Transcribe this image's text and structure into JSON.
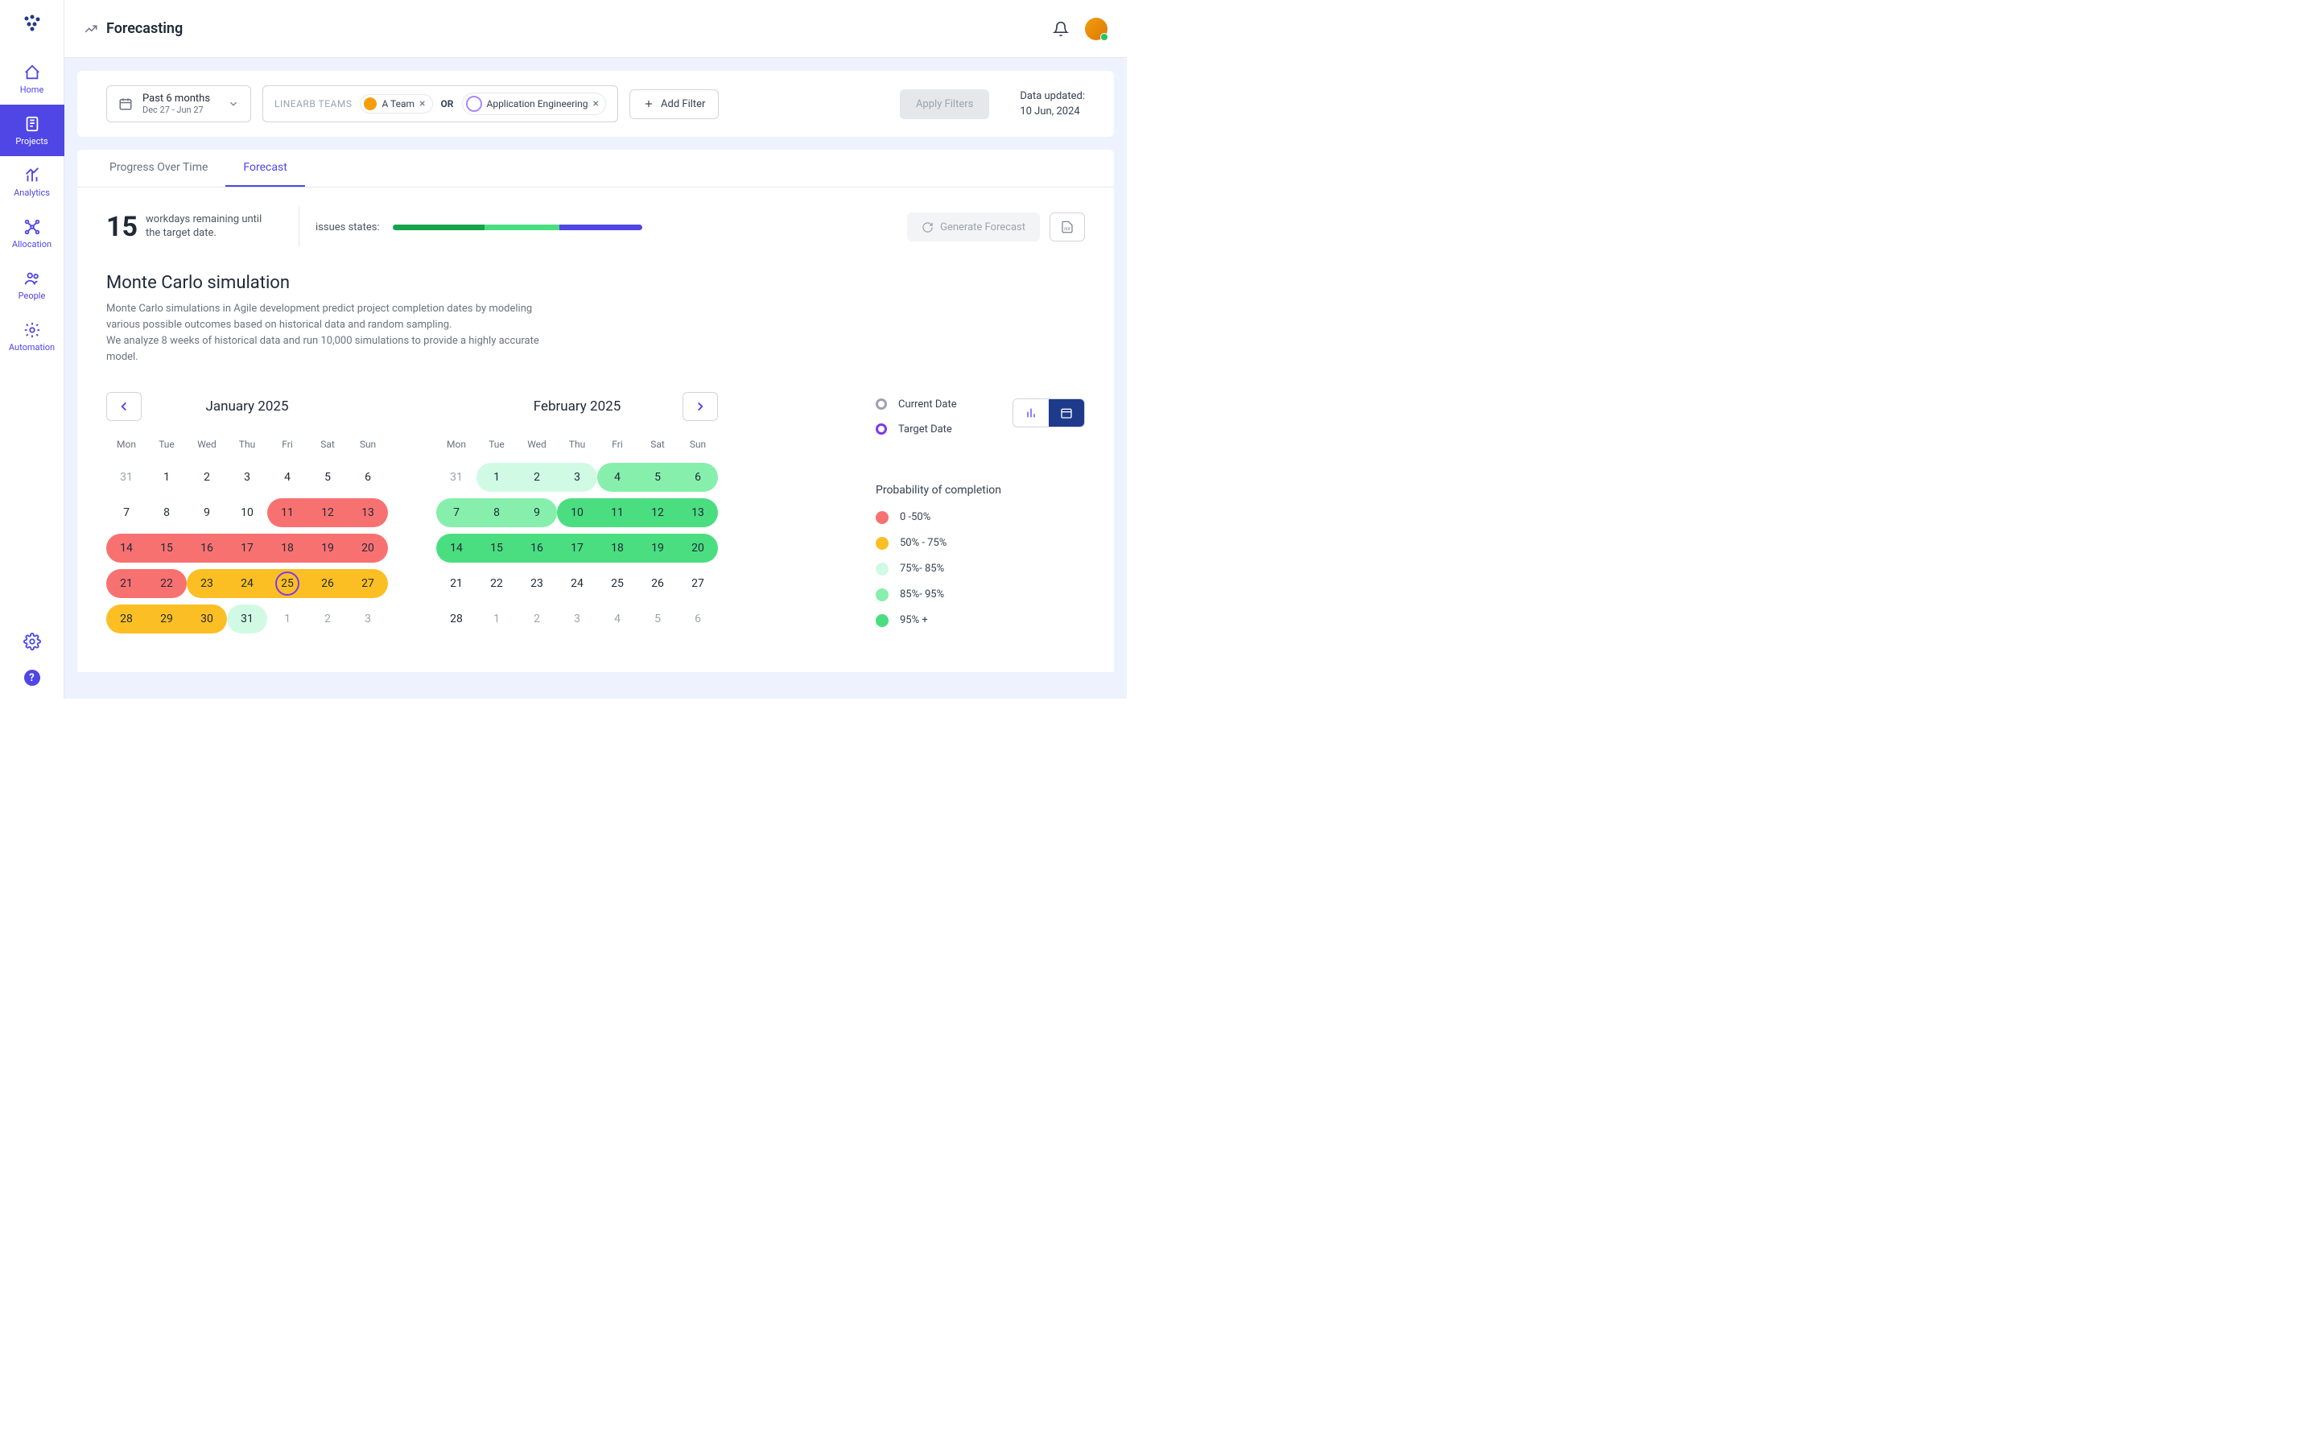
{
  "header": {
    "title": "Forecasting"
  },
  "sidebar": {
    "items": [
      {
        "label": "Home",
        "icon": "home"
      },
      {
        "label": "Projects",
        "icon": "projects",
        "active": true
      },
      {
        "label": "Analytics",
        "icon": "analytics"
      },
      {
        "label": "Allocation",
        "icon": "allocation"
      },
      {
        "label": "People",
        "icon": "people"
      },
      {
        "label": "Automation",
        "icon": "automation"
      }
    ]
  },
  "filters": {
    "date_range_label": "Past 6 months",
    "date_range_sub": "Dec 27 - Jun 27",
    "teams_label": "LINEARB TEAMS",
    "team_a": "A Team",
    "team_b": "Application Engineering",
    "or": "OR",
    "add_filter": "Add Filter",
    "apply": "Apply Filters",
    "data_updated_label": "Data updated:",
    "data_updated_value": "10 Jun, 2024"
  },
  "tabs": {
    "progress": "Progress Over Time",
    "forecast": "Forecast"
  },
  "forecast": {
    "workdays_num": "15",
    "workdays_text": "workdays remaining until the target date.",
    "issues_states_label": "issues states:",
    "generate": "Generate Forecast",
    "mc_title": "Monte Carlo simulation",
    "mc_desc_1": "Monte Carlo simulations in Agile development predict project completion dates by modeling various possible outcomes based on historical data and random sampling.",
    "mc_desc_2": "We analyze 8 weeks of historical data and run 10,000 simulations to provide a highly accurate model."
  },
  "legend": {
    "current_date": "Current Date",
    "target_date": "Target Date",
    "prob_title": "Probability of completion",
    "buckets": [
      {
        "label": "0 -50%",
        "color": "#f87171"
      },
      {
        "label": "50% - 75%",
        "color": "#fbbf24"
      },
      {
        "label": "75%- 85%",
        "color": "#d1fae5"
      },
      {
        "label": "85%- 95%",
        "color": "#86efac"
      },
      {
        "label": "95% +",
        "color": "#4ade80"
      }
    ]
  },
  "calendars": {
    "dow": [
      "Mon",
      "Tue",
      "Wed",
      "Thu",
      "Fri",
      "Sat",
      "Sun"
    ],
    "months": [
      {
        "title": "January 2025",
        "nav": "left",
        "cells": [
          {
            "n": "31",
            "out": true
          },
          {
            "n": "1"
          },
          {
            "n": "2"
          },
          {
            "n": "3"
          },
          {
            "n": "4"
          },
          {
            "n": "5"
          },
          {
            "n": "6"
          },
          {
            "n": "7"
          },
          {
            "n": "8"
          },
          {
            "n": "9"
          },
          {
            "n": "10"
          },
          {
            "n": "11",
            "c": "red",
            "pl": true
          },
          {
            "n": "12",
            "c": "red"
          },
          {
            "n": "13",
            "c": "red",
            "pr": true
          },
          {
            "n": "14",
            "c": "red",
            "pl": true
          },
          {
            "n": "15",
            "c": "red"
          },
          {
            "n": "16",
            "c": "red"
          },
          {
            "n": "17",
            "c": "red"
          },
          {
            "n": "18",
            "c": "red"
          },
          {
            "n": "19",
            "c": "red"
          },
          {
            "n": "20",
            "c": "red",
            "pr": true
          },
          {
            "n": "21",
            "c": "red",
            "pl": true
          },
          {
            "n": "22",
            "c": "red",
            "pr": true
          },
          {
            "n": "23",
            "c": "orange",
            "pl": true
          },
          {
            "n": "24",
            "c": "orange"
          },
          {
            "n": "25",
            "c": "orange",
            "target": true
          },
          {
            "n": "26",
            "c": "orange"
          },
          {
            "n": "27",
            "c": "orange",
            "pr": true
          },
          {
            "n": "28",
            "c": "orange",
            "pl": true
          },
          {
            "n": "29",
            "c": "orange"
          },
          {
            "n": "30",
            "c": "orange",
            "pr": true
          },
          {
            "n": "31",
            "c": "mint",
            "solo": true
          },
          {
            "n": "1",
            "out": true
          },
          {
            "n": "2",
            "out": true
          },
          {
            "n": "3",
            "out": true
          }
        ]
      },
      {
        "title": "February 2025",
        "nav": "right",
        "cells": [
          {
            "n": "31",
            "out": true
          },
          {
            "n": "1",
            "c": "mint",
            "pl": true
          },
          {
            "n": "2",
            "c": "mint"
          },
          {
            "n": "3",
            "c": "mint",
            "pr": true
          },
          {
            "n": "4",
            "c": "lgreen",
            "pl": true
          },
          {
            "n": "5",
            "c": "lgreen"
          },
          {
            "n": "6",
            "c": "lgreen",
            "pr": true
          },
          {
            "n": "7",
            "c": "lgreen",
            "pl": true
          },
          {
            "n": "8",
            "c": "lgreen"
          },
          {
            "n": "9",
            "c": "lgreen",
            "pr": true
          },
          {
            "n": "10",
            "c": "green",
            "pl": true
          },
          {
            "n": "11",
            "c": "green"
          },
          {
            "n": "12",
            "c": "green"
          },
          {
            "n": "13",
            "c": "green",
            "pr": true
          },
          {
            "n": "14",
            "c": "green",
            "pl": true
          },
          {
            "n": "15",
            "c": "green"
          },
          {
            "n": "16",
            "c": "green"
          },
          {
            "n": "17",
            "c": "green"
          },
          {
            "n": "18",
            "c": "green"
          },
          {
            "n": "19",
            "c": "green"
          },
          {
            "n": "20",
            "c": "green",
            "pr": true
          },
          {
            "n": "21"
          },
          {
            "n": "22"
          },
          {
            "n": "23"
          },
          {
            "n": "24"
          },
          {
            "n": "25"
          },
          {
            "n": "26"
          },
          {
            "n": "27"
          },
          {
            "n": "28"
          },
          {
            "n": "1",
            "out": true
          },
          {
            "n": "2",
            "out": true
          },
          {
            "n": "3",
            "out": true
          },
          {
            "n": "4",
            "out": true
          },
          {
            "n": "5",
            "out": true
          },
          {
            "n": "6",
            "out": true
          }
        ]
      }
    ]
  },
  "chart_data": {
    "type": "table",
    "title": "Monte Carlo probability-of-completion heatmap (calendar)",
    "legend": [
      {
        "bucket": "0-50%",
        "color": "#f87171"
      },
      {
        "bucket": "50-75%",
        "color": "#fbbf24"
      },
      {
        "bucket": "75-85%",
        "color": "#d1fae5"
      },
      {
        "bucket": "85-95%",
        "color": "#86efac"
      },
      {
        "bucket": "95%+",
        "color": "#4ade80"
      }
    ],
    "target_date": "2025-01-25",
    "issue_states_bar": {
      "done_pct": 37,
      "in_progress_pct": 30,
      "todo_pct": 33
    },
    "series": [
      {
        "date": "2025-01-11",
        "bucket": "0-50%"
      },
      {
        "date": "2025-01-12",
        "bucket": "0-50%"
      },
      {
        "date": "2025-01-13",
        "bucket": "0-50%"
      },
      {
        "date": "2025-01-14",
        "bucket": "0-50%"
      },
      {
        "date": "2025-01-15",
        "bucket": "0-50%"
      },
      {
        "date": "2025-01-16",
        "bucket": "0-50%"
      },
      {
        "date": "2025-01-17",
        "bucket": "0-50%"
      },
      {
        "date": "2025-01-18",
        "bucket": "0-50%"
      },
      {
        "date": "2025-01-19",
        "bucket": "0-50%"
      },
      {
        "date": "2025-01-20",
        "bucket": "0-50%"
      },
      {
        "date": "2025-01-21",
        "bucket": "0-50%"
      },
      {
        "date": "2025-01-22",
        "bucket": "0-50%"
      },
      {
        "date": "2025-01-23",
        "bucket": "50-75%"
      },
      {
        "date": "2025-01-24",
        "bucket": "50-75%"
      },
      {
        "date": "2025-01-25",
        "bucket": "50-75%"
      },
      {
        "date": "2025-01-26",
        "bucket": "50-75%"
      },
      {
        "date": "2025-01-27",
        "bucket": "50-75%"
      },
      {
        "date": "2025-01-28",
        "bucket": "50-75%"
      },
      {
        "date": "2025-01-29",
        "bucket": "50-75%"
      },
      {
        "date": "2025-01-30",
        "bucket": "50-75%"
      },
      {
        "date": "2025-01-31",
        "bucket": "75-85%"
      },
      {
        "date": "2025-02-01",
        "bucket": "75-85%"
      },
      {
        "date": "2025-02-02",
        "bucket": "75-85%"
      },
      {
        "date": "2025-02-03",
        "bucket": "75-85%"
      },
      {
        "date": "2025-02-04",
        "bucket": "85-95%"
      },
      {
        "date": "2025-02-05",
        "bucket": "85-95%"
      },
      {
        "date": "2025-02-06",
        "bucket": "85-95%"
      },
      {
        "date": "2025-02-07",
        "bucket": "85-95%"
      },
      {
        "date": "2025-02-08",
        "bucket": "85-95%"
      },
      {
        "date": "2025-02-09",
        "bucket": "85-95%"
      },
      {
        "date": "2025-02-10",
        "bucket": "95%+"
      },
      {
        "date": "2025-02-11",
        "bucket": "95%+"
      },
      {
        "date": "2025-02-12",
        "bucket": "95%+"
      },
      {
        "date": "2025-02-13",
        "bucket": "95%+"
      },
      {
        "date": "2025-02-14",
        "bucket": "95%+"
      },
      {
        "date": "2025-02-15",
        "bucket": "95%+"
      },
      {
        "date": "2025-02-16",
        "bucket": "95%+"
      },
      {
        "date": "2025-02-17",
        "bucket": "95%+"
      },
      {
        "date": "2025-02-18",
        "bucket": "95%+"
      },
      {
        "date": "2025-02-19",
        "bucket": "95%+"
      },
      {
        "date": "2025-02-20",
        "bucket": "95%+"
      }
    ]
  }
}
